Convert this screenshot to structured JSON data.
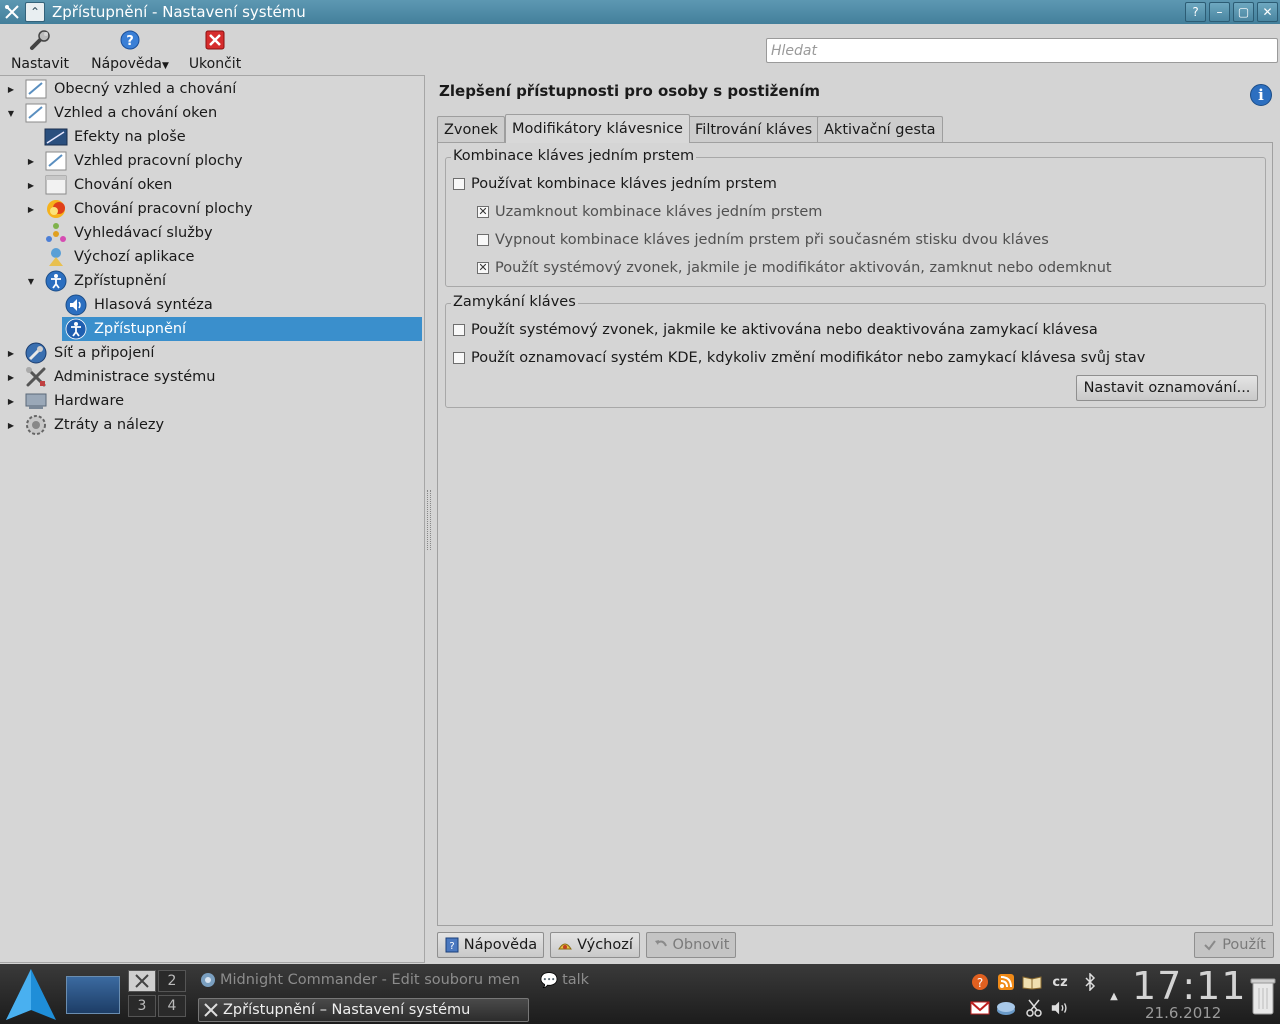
{
  "window": {
    "title": "Zpřístupnění - Nastavení systému",
    "buttons": {
      "help": "?",
      "minimize": "–",
      "maximize": "▢",
      "close": "✕"
    }
  },
  "toolbar": {
    "items": [
      {
        "label": "Nastavit",
        "icon": "wrench-icon"
      },
      {
        "label": "Nápověda",
        "icon": "help-icon"
      },
      {
        "label": "Ukončit",
        "icon": "quit-icon"
      }
    ],
    "search_placeholder": "Hledat"
  },
  "tree": {
    "items": [
      {
        "label": "Obecný vzhled a chování",
        "icon": "appearance-icon",
        "expander": "collapsed",
        "level": 0
      },
      {
        "label": "Vzhled a chování oken",
        "icon": "window-appearance-icon",
        "expander": "expanded",
        "level": 0
      },
      {
        "label": "Efekty na ploše",
        "icon": "desktop-effects-icon",
        "expander": "none",
        "level": 1
      },
      {
        "label": "Vzhled pracovní plochy",
        "icon": "workspace-appearance-icon",
        "expander": "collapsed",
        "level": 1
      },
      {
        "label": "Chování oken",
        "icon": "window-behavior-icon",
        "expander": "collapsed",
        "level": 1
      },
      {
        "label": "Chování pracovní plochy",
        "icon": "workspace-behavior-icon",
        "expander": "collapsed",
        "level": 1
      },
      {
        "label": "Vyhledávací služby",
        "icon": "search-services-icon",
        "expander": "none",
        "level": 1
      },
      {
        "label": "Výchozí aplikace",
        "icon": "default-apps-icon",
        "expander": "none",
        "level": 1
      },
      {
        "label": "Zpřístupnění",
        "icon": "accessibility-icon",
        "expander": "expanded",
        "level": 1
      },
      {
        "label": "Hlasová syntéza",
        "icon": "speech-icon",
        "expander": "none",
        "level": 2
      },
      {
        "label": "Zpřístupnění",
        "icon": "accessibility-icon",
        "expander": "none",
        "level": 2,
        "selected": true
      },
      {
        "label": "Síť a připojení",
        "icon": "network-icon",
        "expander": "collapsed",
        "level": 0
      },
      {
        "label": "Administrace systému",
        "icon": "admin-tools-icon",
        "expander": "collapsed",
        "level": 0
      },
      {
        "label": "Hardware",
        "icon": "hardware-icon",
        "expander": "collapsed",
        "level": 0
      },
      {
        "label": "Ztráty a nálezy",
        "icon": "lost-found-icon",
        "expander": "collapsed",
        "level": 0
      }
    ]
  },
  "content": {
    "heading": "Zlepšení přístupnosti pro osoby s postižením",
    "tabs": [
      {
        "label": "Zvonek",
        "active": false
      },
      {
        "label": "Modifikátory klávesnice",
        "active": true
      },
      {
        "label": "Filtrování kláves",
        "active": false
      },
      {
        "label": "Aktivační gesta",
        "active": false
      }
    ],
    "sticky_group": {
      "title": "Kombinace kláves jedním prstem",
      "options": [
        {
          "label": "Používat kombinace kláves jedním prstem",
          "checked": false,
          "enabled": true
        },
        {
          "label": "Uzamknout kombinace kláves jedním prstem",
          "checked": true,
          "enabled": false
        },
        {
          "label": "Vypnout kombinace kláves jedním prstem při současném stisku dvou kláves",
          "checked": false,
          "enabled": false
        },
        {
          "label": "Použít systémový zvonek, jakmile je modifikátor aktivován, zamknut nebo odemknut",
          "checked": true,
          "enabled": false
        }
      ]
    },
    "lock_group": {
      "title": "Zamykání kláves",
      "options": [
        {
          "label": "Použít systémový zvonek, jakmile ke aktivována nebo deaktivována zamykací klávesa",
          "checked": false,
          "enabled": true
        },
        {
          "label": "Použít oznamovací systém KDE, kdykoliv změní modifikátor nebo zamykací klávesa svůj stav",
          "checked": false,
          "enabled": true
        }
      ],
      "configure_button": "Nastavit oznamování..."
    },
    "bottom_buttons": {
      "help": "Nápověda",
      "defaults": "Výchozí",
      "reset": "Obnovit",
      "apply": "Použít"
    }
  },
  "taskbar": {
    "pager": [
      "1",
      "2",
      "3",
      "4"
    ],
    "tasks": [
      {
        "label": "Midnight Commander - Edit souboru men",
        "icon": "chromium-icon",
        "active": false
      },
      {
        "label": "talk",
        "icon": "chat-icon",
        "active": false
      },
      {
        "label": "Zpřístupnění – Nastavení systému",
        "icon": "settings-icon",
        "active": true
      }
    ],
    "keyboard_layout": "cz",
    "clock": "17:11",
    "date": "21.6.2012"
  }
}
